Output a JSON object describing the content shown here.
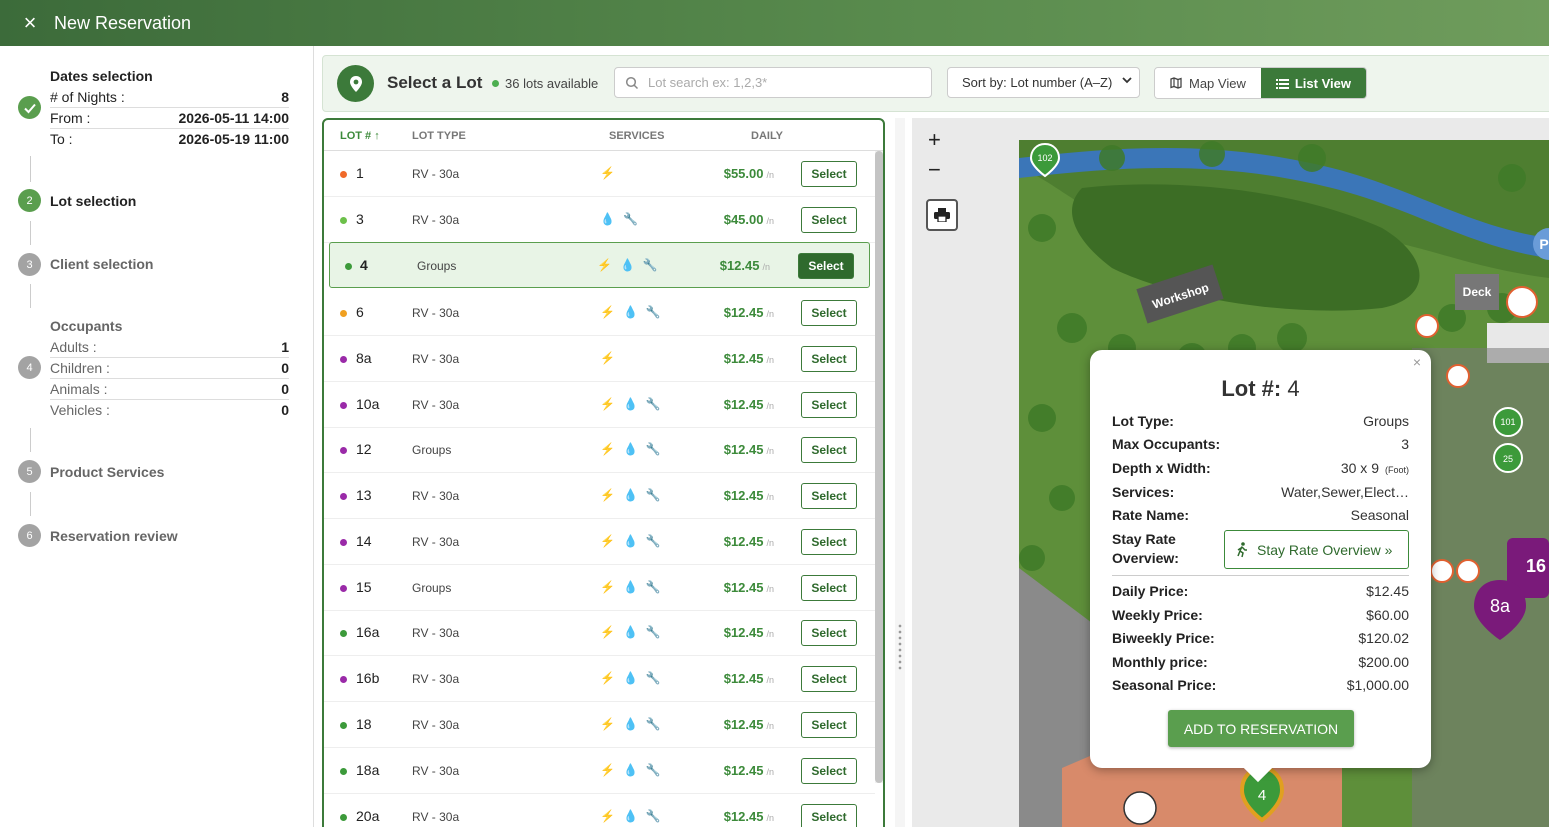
{
  "app": {
    "title": "New Reservation",
    "close_icon": "×"
  },
  "stepper": {
    "dates": {
      "title": "Dates selection",
      "nights_label": "# of Nights :",
      "nights": "8",
      "from_label": "From :",
      "from": "2026-05-11 14:00",
      "to_label": "To :",
      "to": "2026-05-19 11:00"
    },
    "steps": [
      {
        "num": "2",
        "label": "Lot selection"
      },
      {
        "num": "3",
        "label": "Client selection"
      },
      {
        "num": "4",
        "label": "Occupants"
      },
      {
        "num": "5",
        "label": "Product Services"
      },
      {
        "num": "6",
        "label": "Reservation review"
      }
    ],
    "occupants": {
      "adults_label": "Adults :",
      "adults": "1",
      "children_label": "Children :",
      "children": "0",
      "animals_label": "Animals :",
      "animals": "0",
      "vehicles_label": "Vehicles :",
      "vehicles": "0"
    }
  },
  "header": {
    "title": "Select a Lot",
    "available": "36 lots available",
    "search_placeholder": "Lot search ex: 1,2,3*",
    "sort_label": "Sort by: Lot number (A–Z)",
    "map_view": "Map View",
    "list_view": "List View"
  },
  "table": {
    "columns": {
      "lot": "LOT #",
      "type": "LOT TYPE",
      "services": "SERVICES",
      "daily": "DAILY"
    },
    "per_night": "/n",
    "select_label": "Select",
    "rows": [
      {
        "lot": "1",
        "type": "RV - 30a",
        "price": "$55.00",
        "dot": "#f06a2a",
        "bolt": true,
        "drop": false,
        "plug": false
      },
      {
        "lot": "3",
        "type": "RV - 30a",
        "price": "$45.00",
        "dot": "#6cc04a",
        "bolt": false,
        "drop": true,
        "plug": true
      },
      {
        "lot": "4",
        "type": "Groups",
        "price": "$12.45",
        "dot": "#3c9a3a",
        "bolt": true,
        "drop": true,
        "plug": true,
        "selected": true
      },
      {
        "lot": "6",
        "type": "RV - 30a",
        "price": "$12.45",
        "dot": "#f0a020",
        "bolt": true,
        "drop": true,
        "plug": true
      },
      {
        "lot": "8a",
        "type": "RV - 30a",
        "price": "$12.45",
        "dot": "#9a2aa8",
        "bolt": true,
        "drop": false,
        "plug": false
      },
      {
        "lot": "10a",
        "type": "RV - 30a",
        "price": "$12.45",
        "dot": "#9a2aa8",
        "bolt": true,
        "drop": true,
        "plug": true
      },
      {
        "lot": "12",
        "type": "Groups",
        "price": "$12.45",
        "dot": "#9a2aa8",
        "bolt": true,
        "drop": true,
        "plug": true
      },
      {
        "lot": "13",
        "type": "RV - 30a",
        "price": "$12.45",
        "dot": "#9a2aa8",
        "bolt": true,
        "drop": true,
        "plug": true
      },
      {
        "lot": "14",
        "type": "RV - 30a",
        "price": "$12.45",
        "dot": "#9a2aa8",
        "bolt": true,
        "drop": true,
        "plug": true
      },
      {
        "lot": "15",
        "type": "Groups",
        "price": "$12.45",
        "dot": "#9a2aa8",
        "bolt": true,
        "drop": true,
        "plug": true
      },
      {
        "lot": "16a",
        "type": "RV - 30a",
        "price": "$12.45",
        "dot": "#3c9a3a",
        "bolt": true,
        "drop": true,
        "plug": true
      },
      {
        "lot": "16b",
        "type": "RV - 30a",
        "price": "$12.45",
        "dot": "#9a2aa8",
        "bolt": true,
        "drop": true,
        "plug": true
      },
      {
        "lot": "18",
        "type": "RV - 30a",
        "price": "$12.45",
        "dot": "#3c9a3a",
        "bolt": true,
        "drop": true,
        "plug": true
      },
      {
        "lot": "18a",
        "type": "RV - 30a",
        "price": "$12.45",
        "dot": "#3c9a3a",
        "bolt": true,
        "drop": true,
        "plug": true
      },
      {
        "lot": "20a",
        "type": "RV - 30a",
        "price": "$12.45",
        "dot": "#3c9a3a",
        "bolt": true,
        "drop": true,
        "plug": true
      }
    ]
  },
  "map": {
    "zoom_in": "+",
    "zoom_out": "−",
    "labels": {
      "workshop": "Workshop",
      "deck": "Deck",
      "lot102": "102",
      "lot101": "101",
      "lot25": "25",
      "lot8a": "8a",
      "lot16": "16",
      "lot4": "4",
      "p": "P"
    }
  },
  "popup": {
    "title_label": "Lot #:",
    "title_value": "4",
    "lot_type_label": "Lot Type:",
    "lot_type": "Groups",
    "max_occ_label": "Max Occupants:",
    "max_occ": "3",
    "depth_label": "Depth x Width:",
    "depth": "30 x 9",
    "depth_unit": "(Foot)",
    "services_label": "Services:",
    "services": "Water,Sewer,Elect…",
    "rate_name_label": "Rate Name:",
    "rate_name": "Seasonal",
    "stay_label": "Stay Rate Overview:",
    "stay_button": "Stay Rate Overview »",
    "daily_label": "Daily Price:",
    "daily": "$12.45",
    "weekly_label": "Weekly Price:",
    "weekly": "$60.00",
    "biweekly_label": "Biweekly Price:",
    "biweekly": "$120.02",
    "monthly_label": "Monthly price:",
    "monthly": "$200.00",
    "seasonal_label": "Seasonal Price:",
    "seasonal": "$1,000.00",
    "add_button": "ADD TO RESERVATION"
  }
}
